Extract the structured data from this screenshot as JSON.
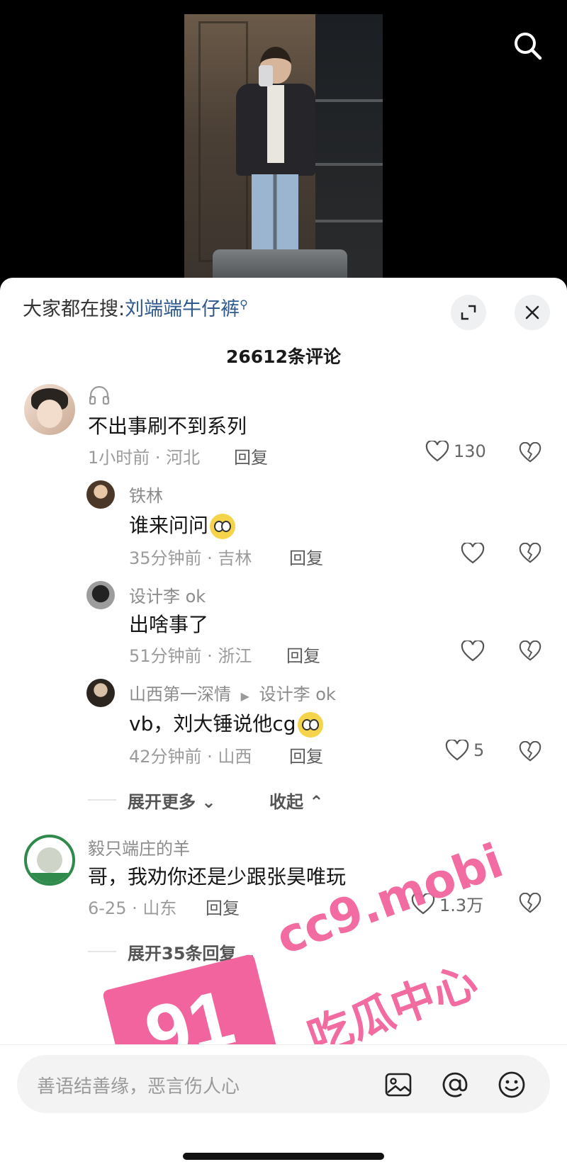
{
  "video": {
    "search_icon": "search-icon"
  },
  "sheet": {
    "trending_prefix": "大家都在搜:",
    "trending_keyword": "刘端端牛仔裤",
    "comment_count": "26612条评论"
  },
  "comments": [
    {
      "user": "",
      "headphone_icon": "headphones-icon",
      "text": "不出事刷不到系列",
      "meta": "1小时前 · 河北",
      "reply_label": "回复",
      "likes": "130",
      "replies": [
        {
          "user": "铁林",
          "text": "谁来问问",
          "meta": "35分钟前 · 吉林",
          "reply_label": "回复",
          "likes": ""
        },
        {
          "user": "设计李 ok",
          "text": "出啥事了",
          "meta": "51分钟前 · 浙江",
          "reply_label": "回复",
          "likes": ""
        },
        {
          "user": "山西第一深情",
          "reply_to": "设计李 ok",
          "text": "vb，刘大锤说他cg",
          "meta": "42分钟前 · 山西",
          "reply_label": "回复",
          "likes": "5"
        }
      ],
      "expand_more": "展开更多",
      "collapse": "收起"
    },
    {
      "user": "毅只端庄的羊",
      "text": "哥，我劝你还是少跟张昊唯玩",
      "meta": "6-25 · 山东",
      "reply_label": "回复",
      "likes": "1.3万",
      "expand_replies": "展开35条回复"
    }
  ],
  "input": {
    "placeholder": "善语结善缘，恶言伤人心"
  },
  "watermark": {
    "number": "91",
    "domain": "cc9.mobi",
    "slogan": "吃瓜中心"
  },
  "colors": {
    "link": "#2f5a8e",
    "watermark": "#f2649d",
    "sheet_bg": "#ffffff"
  }
}
